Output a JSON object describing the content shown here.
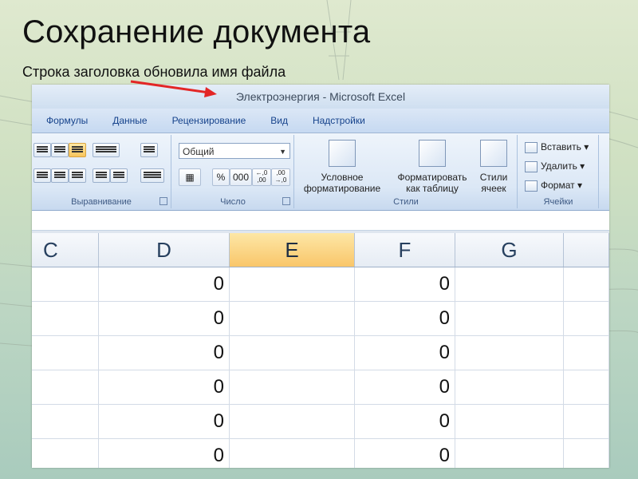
{
  "slide": {
    "title": "Сохранение документа",
    "subtitle": "Строка заголовка обновила имя файла"
  },
  "excel": {
    "window_title": "Электроэнергия - Microsoft Excel",
    "tabs": [
      "Формулы",
      "Данные",
      "Рецензирование",
      "Вид",
      "Надстройки"
    ],
    "ribbon": {
      "alignment_group_label": "Выравнивание",
      "number_group_label": "Число",
      "number_format_value": "Общий",
      "number_buttons": [
        "%",
        "000",
        "←,0 ,00",
        ",00 →,0"
      ],
      "styles_group_label": "Стили",
      "conditional_formatting": "Условное форматирование",
      "format_as_table": "Форматировать как таблицу",
      "cell_styles": "Стили ячеек",
      "cells_group_label": "Ячейки",
      "insert_label": "Вставить",
      "delete_label": "Удалить",
      "format_label": "Формат"
    },
    "columns": [
      "C",
      "D",
      "E",
      "F",
      "G"
    ],
    "selected_column": "E",
    "rows": [
      [
        "",
        "0",
        "",
        "0",
        ""
      ],
      [
        "",
        "0",
        "",
        "0",
        ""
      ],
      [
        "",
        "0",
        "",
        "0",
        ""
      ],
      [
        "",
        "0",
        "",
        "0",
        ""
      ],
      [
        "",
        "0",
        "",
        "0",
        ""
      ],
      [
        "",
        "0",
        "",
        "0",
        ""
      ]
    ],
    "colors": {
      "accent": "#15428b",
      "selected_header": "#f9c66a",
      "annotation_arrow": "#e32626"
    }
  }
}
